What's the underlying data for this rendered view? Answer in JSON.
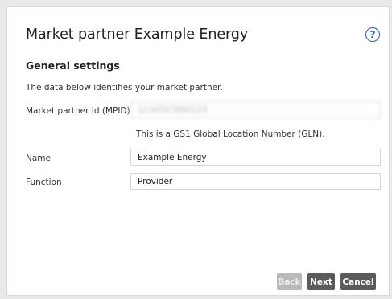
{
  "dialog": {
    "title": "Market partner Example Energy",
    "help_icon": "question-circle-icon"
  },
  "general": {
    "section_title": "General settings",
    "intro": "The data below identifies your market partner."
  },
  "fields": {
    "mpid": {
      "label": "Market partner Id (MPID)",
      "value": "1234567890123",
      "hint": "This is a GS1 Global Location Number (GLN)."
    },
    "name": {
      "label": "Name",
      "value": "Example Energy"
    },
    "function": {
      "label": "Function",
      "value": "Provider"
    }
  },
  "buttons": {
    "back": "Back",
    "next": "Next",
    "cancel": "Cancel"
  },
  "colors": {
    "accent": "#2a56c6",
    "button_active": "#5b5b5b",
    "button_disabled": "#b9b9b9"
  }
}
